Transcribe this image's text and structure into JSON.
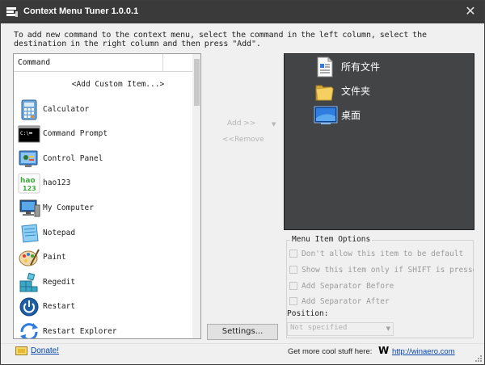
{
  "window": {
    "title": "Context Menu Tuner 1.0.0.1",
    "close_glyph": "✕"
  },
  "instructions": "To add new command to the context menu, select the command in the left column, select the destination in the right column and then press \"Add\".",
  "command_list": {
    "header": "Command",
    "items": [
      {
        "label": "<Add Custom Item...>",
        "icon": "none"
      },
      {
        "label": "Calculator",
        "icon": "calculator-icon"
      },
      {
        "label": "Command Prompt",
        "icon": "command-prompt-icon"
      },
      {
        "label": "Control Panel",
        "icon": "control-panel-icon"
      },
      {
        "label": "hao123",
        "icon": "hao123-icon"
      },
      {
        "label": "My Computer",
        "icon": "my-computer-icon"
      },
      {
        "label": "Notepad",
        "icon": "notepad-icon"
      },
      {
        "label": "Paint",
        "icon": "paint-icon"
      },
      {
        "label": "Regedit",
        "icon": "regedit-icon"
      },
      {
        "label": "Restart",
        "icon": "restart-icon"
      },
      {
        "label": "Restart Explorer",
        "icon": "restart-explorer-icon"
      }
    ]
  },
  "actions": {
    "add_label": "Add >>",
    "remove_label": "<<Remove",
    "settings_label": "Settings..."
  },
  "destinations": [
    {
      "label": "所有文件",
      "icon": "all-files-icon"
    },
    {
      "label": "文件夹",
      "icon": "folder-icon"
    },
    {
      "label": "桌面",
      "icon": "desktop-icon"
    }
  ],
  "options": {
    "legend": "Menu Item Options",
    "checkboxes": [
      {
        "label": "Don't allow this item to be default",
        "checked": false,
        "enabled": false
      },
      {
        "label": "Show this item only if SHIFT is pressed",
        "checked": false,
        "enabled": false
      },
      {
        "label": "Add Separator Before",
        "checked": false,
        "enabled": false
      },
      {
        "label": "Add Separator After",
        "checked": false,
        "enabled": false
      }
    ],
    "position_label": "Position:",
    "position_value": "Not specified"
  },
  "footer": {
    "donate_label": "Donate!",
    "get_more_label": "Get more cool stuff here:",
    "logo_letter": "W",
    "website_label": "http://winaero.com"
  },
  "colors": {
    "titlebar": "#3a3a3a",
    "destination_panel": "#424446",
    "link": "#0645ad"
  }
}
